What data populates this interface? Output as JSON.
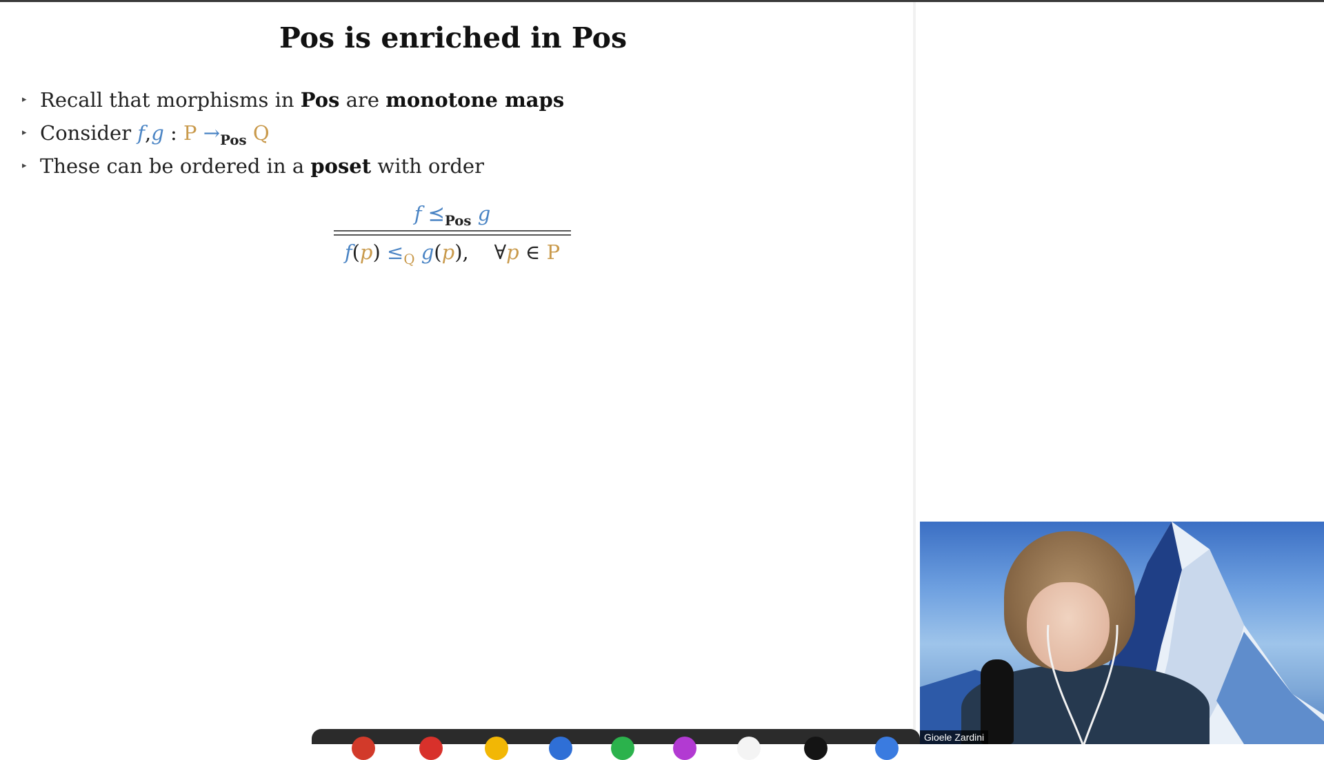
{
  "slide": {
    "title": "Pos is enriched in Pos",
    "bullets": [
      {
        "t1": "Recall that morphisms in ",
        "b1": "Pos",
        "t2": " are ",
        "b2": "monotone maps"
      },
      {
        "t1": "Consider ",
        "f": "f",
        "comma": ",",
        "g": "g",
        "colon": " : ",
        "P": "P",
        "arrow": " →",
        "sub": "Pos",
        "Q": "Q"
      },
      {
        "t1": "These can be ordered in a ",
        "b1": "poset",
        "t2": " with order"
      }
    ],
    "fraction": {
      "num_f": "f",
      "num_leq": " ⪯",
      "num_sub": "Pos",
      "num_g": "g",
      "den_f": "f",
      "den_lp1": "(",
      "den_p1": "p",
      "den_rp1": ")",
      "den_leq": " ≤",
      "den_sub": "Q",
      "den_g": "g",
      "den_lp2": "(",
      "den_p2": "p",
      "den_rp2": "),",
      "den_forall": "∀",
      "den_p3": "p",
      "den_in": " ∈ ",
      "den_P": "P"
    }
  },
  "video": {
    "participant_name": "Gioele Zardini"
  },
  "dock": {
    "icons": [
      {
        "name": "red-app-icon",
        "color": "#d23a2a"
      },
      {
        "name": "red-app-icon-2",
        "color": "#d8312b"
      },
      {
        "name": "yellow-app-icon",
        "color": "#f2b705"
      },
      {
        "name": "blue-app-icon",
        "color": "#2f6fd6"
      },
      {
        "name": "green-app-icon",
        "color": "#2bb24c"
      },
      {
        "name": "purple-app-icon",
        "color": "#b23ad2"
      },
      {
        "name": "white-app-icon",
        "color": "#f4f4f4"
      },
      {
        "name": "black-app-icon",
        "color": "#141414"
      },
      {
        "name": "blue-app-icon-2",
        "color": "#3a7be0"
      }
    ]
  },
  "colors": {
    "accent_blue": "#4a84c4",
    "accent_orange": "#c99a4c"
  }
}
